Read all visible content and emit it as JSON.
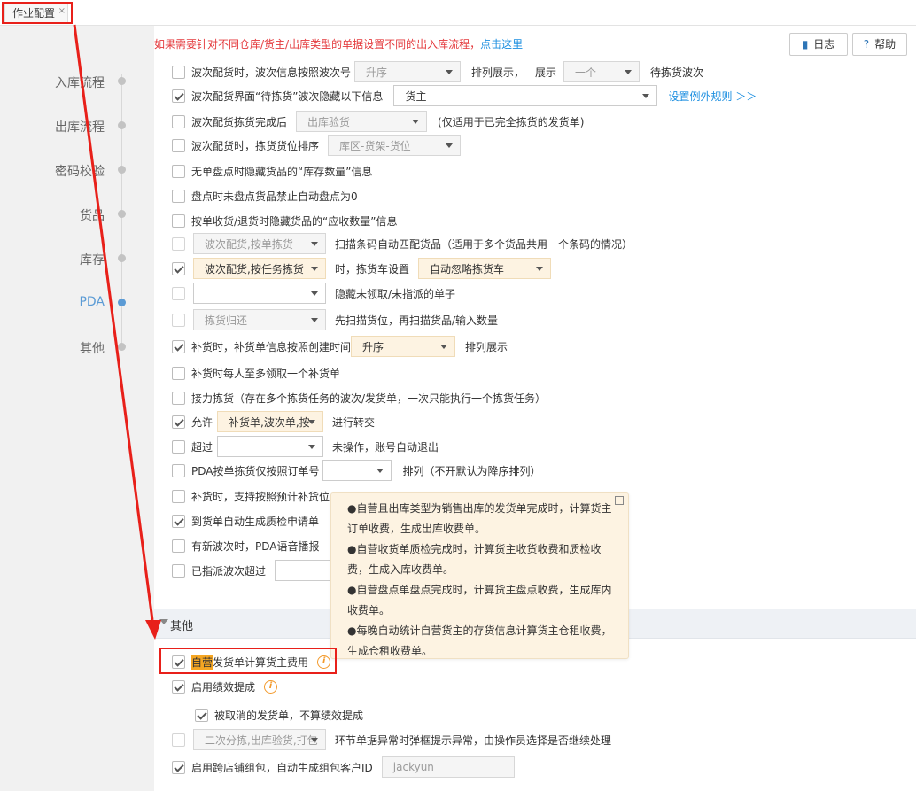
{
  "tab": {
    "title": "作业配置",
    "close": "×"
  },
  "notice": {
    "text": "如果需要针对不同仓库/货主/出库类型的单据设置不同的出入库流程，",
    "link": "点击这里"
  },
  "header_buttons": {
    "log": "日志",
    "help": "帮助"
  },
  "sidebar": {
    "items": [
      {
        "label": "入库流程",
        "active": false
      },
      {
        "label": "出库流程",
        "active": false
      },
      {
        "label": "密码校验",
        "active": false
      },
      {
        "label": "货品",
        "active": false
      },
      {
        "label": "库存",
        "active": false
      },
      {
        "label": "PDA",
        "active": true
      },
      {
        "label": "其他",
        "active": false
      }
    ]
  },
  "rows": {
    "r1": {
      "checked": false,
      "text": "波次配货时，波次信息按照波次号",
      "select": "升序",
      "text2": "排列展示，",
      "text3": "展示",
      "select2": "一个",
      "text4": "待拣货波次"
    },
    "r2": {
      "checked": true,
      "text": "波次配货界面“待拣货”波次隐藏以下信息",
      "select": "货主",
      "link": "设置例外规则 ＞＞"
    },
    "r3": {
      "checked": false,
      "text": "波次配货拣货完成后",
      "select": "出库验货",
      "text2": "(仅适用于已完全拣货的发货单)"
    },
    "r4": {
      "checked": false,
      "text": "波次配货时，拣货货位排序",
      "select": "库区-货架-货位"
    },
    "r5": {
      "checked": false,
      "text": "无单盘点时隐藏货品的“库存数量”信息"
    },
    "r6": {
      "checked": false,
      "text": "盘点时未盘点货品禁止自动盘点为0"
    },
    "r7": {
      "checked": false,
      "text": "按单收货/退货时隐藏货品的“应收数量”信息"
    },
    "r8": {
      "checked": false,
      "select": "波次配货,按单拣货",
      "text": "扫描条码自动匹配货品（适用于多个货品共用一个条码的情况）"
    },
    "r9": {
      "checked": true,
      "select": "波次配货,按任务拣货",
      "text": "时，拣货车设置",
      "select2": "自动忽略拣货车"
    },
    "r10": {
      "checked": false,
      "select": "",
      "text": "隐藏未领取/未指派的单子"
    },
    "r11": {
      "checked": false,
      "select": "拣货归还",
      "text": "先扫描货位，再扫描货品/输入数量"
    },
    "r12": {
      "checked": true,
      "text": "补货时，补货单信息按照创建时间",
      "select": "升序",
      "text2": "排列展示"
    },
    "r13": {
      "checked": false,
      "text": "补货时每人至多领取一个补货单"
    },
    "r14": {
      "checked": false,
      "text": "接力拣货（存在多个拣货任务的波次/发货单，一次只能执行一个拣货任务）"
    },
    "r15": {
      "checked": true,
      "text": "允许",
      "select": "补货单,波次单,按",
      "text2": "进行转交"
    },
    "r16": {
      "checked": false,
      "text": "超过",
      "select": "",
      "text2": "未操作，账号自动退出"
    },
    "r17": {
      "checked": false,
      "text": "PDA按单拣货仅按照订单号",
      "select": "",
      "text2": "排列（不开默认为降序排列）"
    },
    "r18": {
      "checked": false,
      "text": "补货时，支持按照预计补货位"
    },
    "r19": {
      "checked": true,
      "text": "到货单自动生成质检申请单"
    },
    "r20": {
      "checked": false,
      "text": "有新波次时，PDA语音播报"
    },
    "r21": {
      "checked": false,
      "text": "已指派波次超过"
    }
  },
  "section_other": {
    "label": "其他"
  },
  "other_rows": {
    "o1": {
      "checked": true,
      "highlight": "自营",
      "text": "发货单计算货主费用"
    },
    "o2": {
      "checked": true,
      "text": "启用绩效提成"
    },
    "o3": {
      "checked": true,
      "text": "被取消的发货单，不算绩效提成"
    },
    "o4": {
      "checked": false,
      "select": "二次分拣,出库验货,打包",
      "text": "环节单据异常时弹框提示异常，由操作员选择是否继续处理"
    },
    "o5": {
      "checked": true,
      "text": "启用跨店铺组包，自动生成组包客户ID",
      "input_value": "jackyun"
    }
  },
  "popup": {
    "lines": [
      "●自营且出库类型为销售出库的发货单完成时，计算货主订单收费，生成出库收费单。",
      "●自营收货单质检完成时，计算货主收货收费和质检收费，生成入库收费单。",
      "●自营盘点单盘点完成时，计算货主盘点收费，生成库内收费单。",
      "●每晚自动统计自营货主的存货信息计算货主仓租收费，生成仓租收费单。"
    ]
  },
  "colors": {
    "annotation": "#e8201a",
    "link": "#1d8fe0",
    "notice": "#e4393c",
    "active_nav": "#5b9bd5",
    "warning_icon": "#f39a2c"
  }
}
